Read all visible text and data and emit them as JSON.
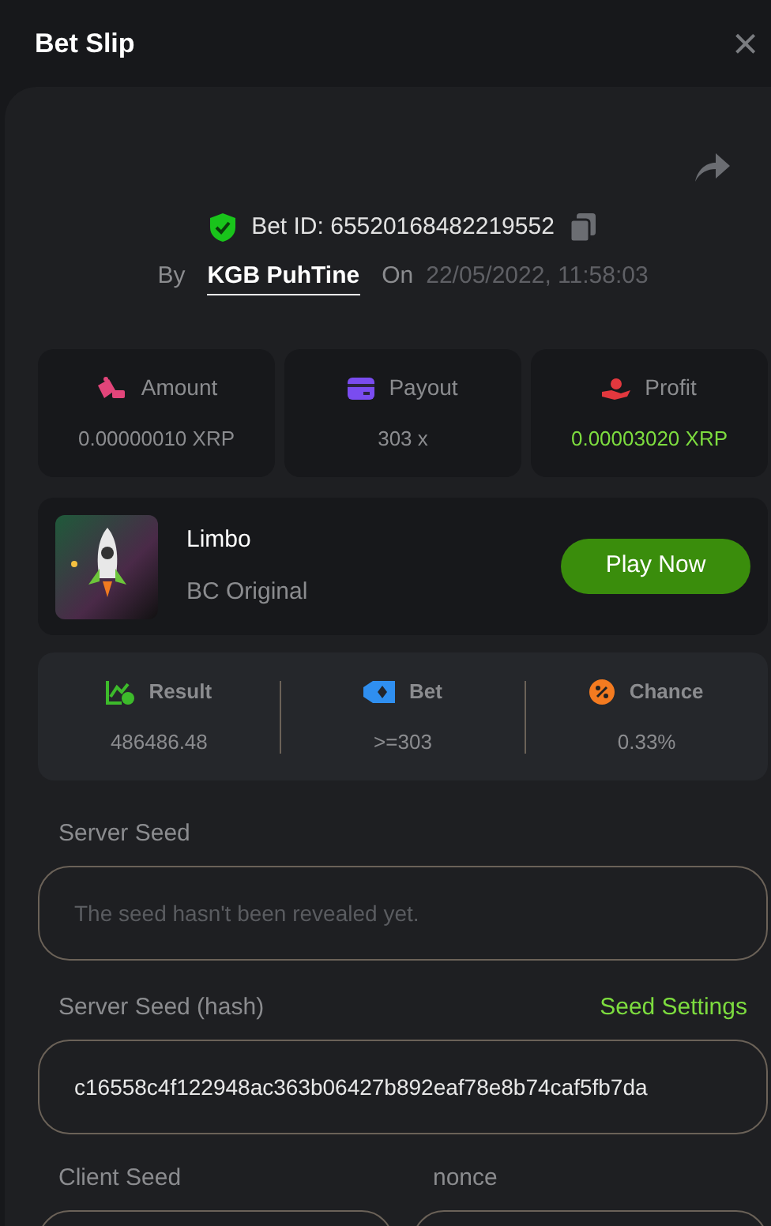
{
  "header": {
    "title": "Bet Slip",
    "close": "×"
  },
  "bet_info": {
    "bet_id": "Bet ID: 65520168482219552",
    "verified": true,
    "by_label": "By",
    "user": "KGB PuhTine",
    "on_label": "On",
    "date": "22/05/2022, 11:58:03"
  },
  "stats": [
    {
      "kind": "amount",
      "label": "Amount",
      "value": "0.00000010 XRP",
      "color": "#e2457a",
      "positive": false
    },
    {
      "kind": "payout",
      "label": "Payout",
      "value": "303 x",
      "color": "#7a4cf0",
      "positive": false
    },
    {
      "kind": "profit",
      "label": "Profit",
      "value": "0.00003020 XRP",
      "color": "#e2383e",
      "positive": true
    }
  ],
  "game": {
    "name": "Limbo",
    "provider": "BC Original",
    "button": "Play Now"
  },
  "result": [
    {
      "kind": "result",
      "label": "Result",
      "value": "486486.48",
      "color": "#3dbb2b"
    },
    {
      "kind": "bet",
      "label": "Bet",
      "value": ">=303",
      "color": "#2f8ff0"
    },
    {
      "kind": "chance",
      "label": "Chance",
      "value": "0.33%",
      "color": "#f47b20"
    }
  ],
  "server_seed": {
    "label": "Server Seed",
    "placeholder": "The seed hasn't been revealed yet."
  },
  "server_seed_hash": {
    "label": "Server Seed (hash)",
    "link": "Seed Settings",
    "value": "c16558c4f122948ac363b06427b892eaf78e8b74caf5fb7da"
  },
  "client_seed": {
    "label": "Client Seed"
  },
  "nonce": {
    "label": "nonce"
  }
}
